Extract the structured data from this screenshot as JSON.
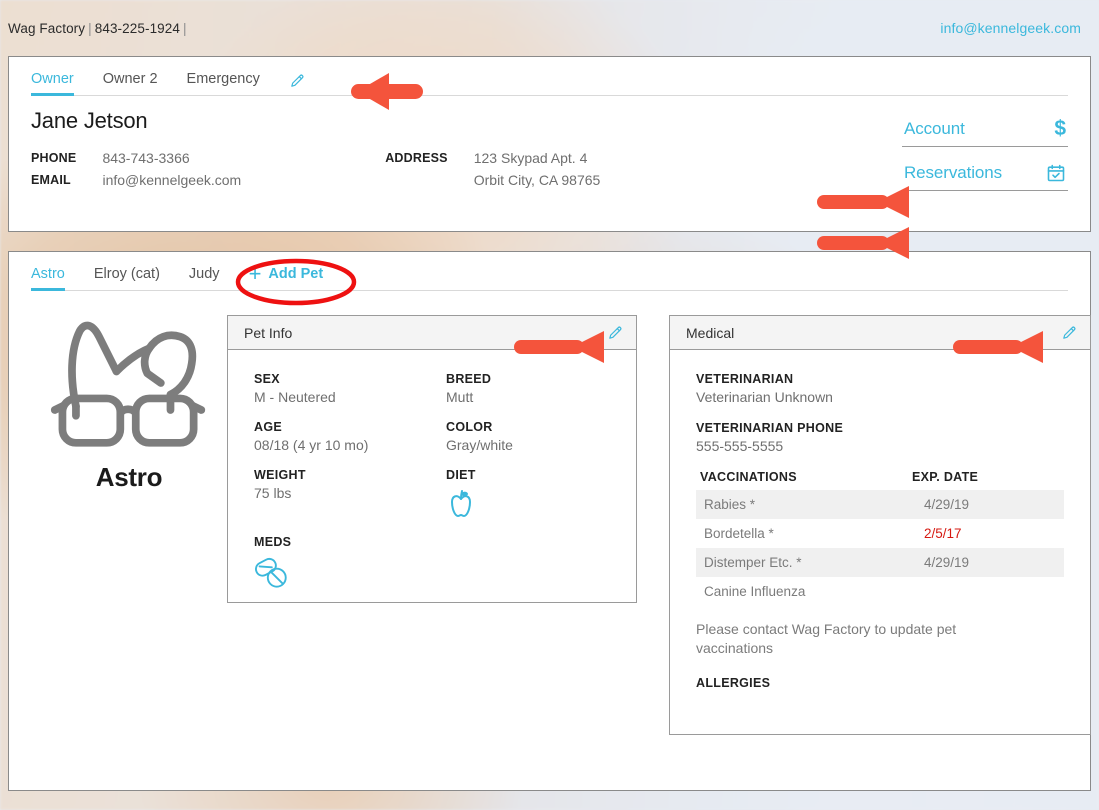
{
  "header": {
    "business_name": "Wag Factory",
    "separator": "|",
    "phone": "843-225-1924",
    "email": "info@kennelgeek.com"
  },
  "owner_card": {
    "tabs": [
      {
        "label": "Owner",
        "active": true
      },
      {
        "label": "Owner 2",
        "active": false
      },
      {
        "label": "Emergency",
        "active": false
      }
    ],
    "edit_icon": "pencil-icon",
    "name": "Jane Jetson",
    "fields": {
      "phone_label": "PHONE",
      "phone_value": "843-743-3366",
      "email_label": "EMAIL",
      "email_value": "info@kennelgeek.com",
      "address_label": "ADDRESS",
      "address_line1": "123 Skypad Apt. 4",
      "address_line2": "Orbit City, CA 98765"
    },
    "quick_links": [
      {
        "label": "Account",
        "icon": "dollar-sign-icon"
      },
      {
        "label": "Reservations",
        "icon": "calendar-check-icon"
      }
    ]
  },
  "pet_card": {
    "tabs": [
      {
        "label": "Astro",
        "active": true
      },
      {
        "label": "Elroy (cat)",
        "active": false
      },
      {
        "label": "Judy",
        "active": false
      }
    ],
    "add_pet": {
      "plus": "+",
      "label": "Add Pet"
    },
    "avatar": {
      "icon": "dog-with-glasses-icon",
      "name": "Astro"
    },
    "pet_info": {
      "title": "Pet Info",
      "edit_icon": "pencil-icon",
      "sex_label": "SEX",
      "sex_value": "M - Neutered",
      "breed_label": "BREED",
      "breed_value": "Mutt",
      "age_label": "AGE",
      "age_value": "08/18 (4 yr 10 mo)",
      "color_label": "COLOR",
      "color_value": "Gray/white",
      "weight_label": "WEIGHT",
      "weight_value": "75 lbs",
      "diet_label": "DIET",
      "diet_icon": "apple-icon",
      "meds_label": "MEDS",
      "meds_icon": "pills-icon"
    },
    "medical": {
      "title": "Medical",
      "edit_icon": "pencil-icon",
      "veterinarian_label": "VETERINARIAN",
      "veterinarian_value": "Veterinarian Unknown",
      "vet_phone_label": "VETERINARIAN PHONE",
      "vet_phone_value": "555-555-5555",
      "vaccinations_label": "VACCINATIONS",
      "exp_date_label": "EXP. DATE",
      "vaccinations": [
        {
          "name": "Rabies *",
          "date": "4/29/19",
          "expired": false,
          "striped": true
        },
        {
          "name": "Bordetella *",
          "date": "2/5/17",
          "expired": true,
          "striped": false
        },
        {
          "name": "Distemper Etc. *",
          "date": "4/29/19",
          "expired": false,
          "striped": true
        },
        {
          "name": "Canine Influenza",
          "date": "",
          "expired": false,
          "striped": false
        }
      ],
      "note": "Please contact Wag Factory to update pet vaccinations",
      "allergies_label": "ALLERGIES",
      "allergies_value": ""
    }
  },
  "annotations": {
    "arrow_color": "#F4543C",
    "ellipse_color": "#EE1111",
    "items": [
      {
        "type": "arrow",
        "target": "owner-edit-pencil"
      },
      {
        "type": "arrow",
        "target": "account-link"
      },
      {
        "type": "arrow",
        "target": "reservations-link"
      },
      {
        "type": "ellipse",
        "target": "add-pet-button"
      },
      {
        "type": "arrow",
        "target": "pet-info-edit-pencil"
      },
      {
        "type": "arrow",
        "target": "medical-edit-pencil"
      }
    ]
  },
  "colors": {
    "accent_cyan": "#3BB8DC",
    "expired_red": "#D61A12",
    "page_bg": "#E6EAF0",
    "panel_head": "#F4F4F4",
    "row_stripe": "#F0F0F0"
  }
}
